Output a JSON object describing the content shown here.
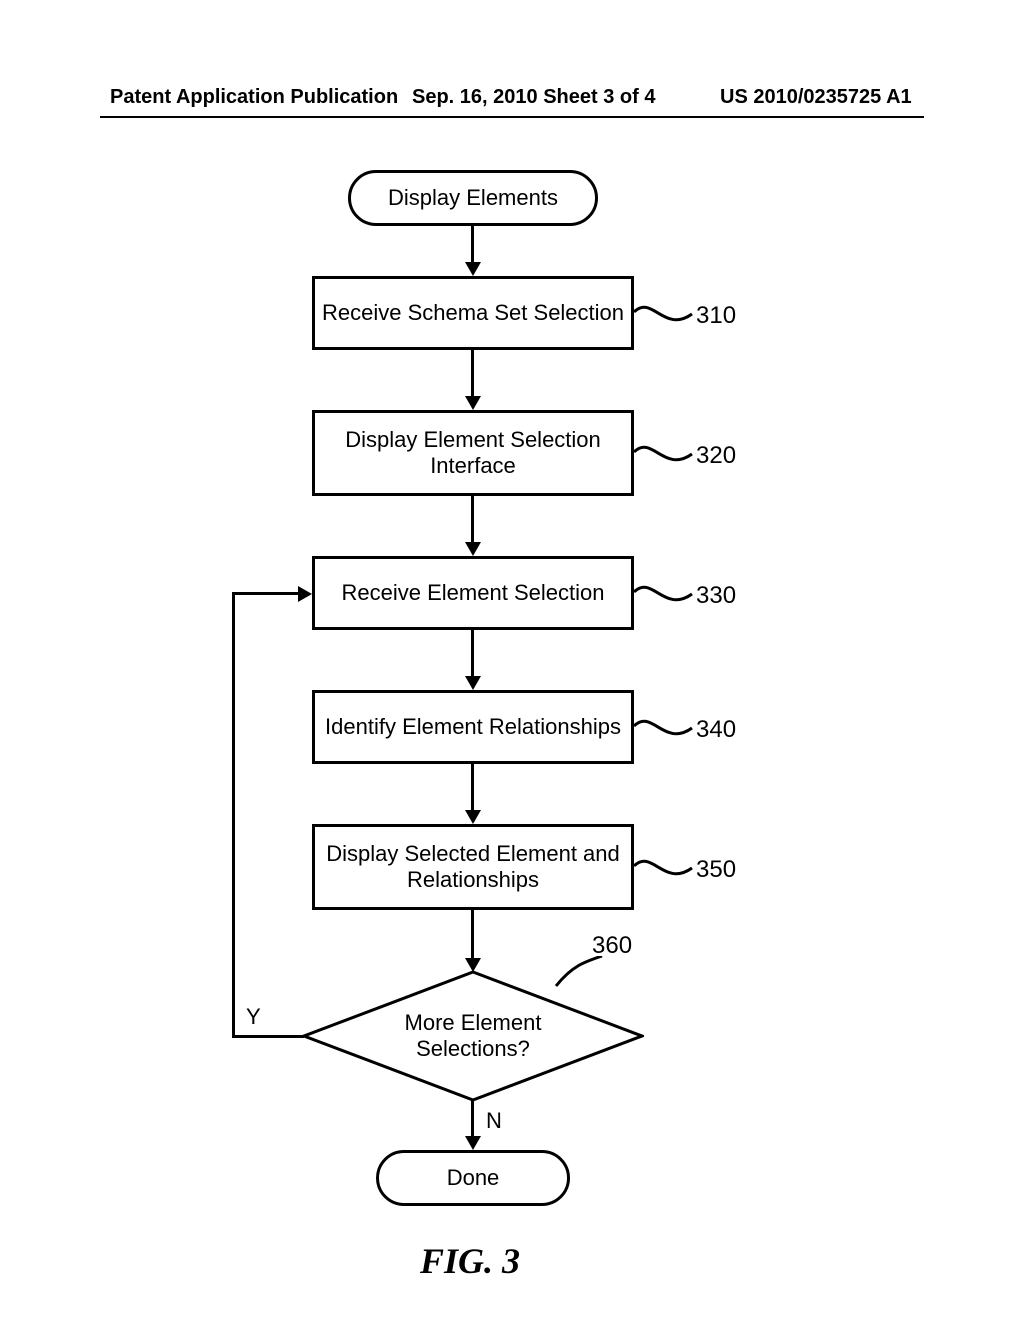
{
  "header": {
    "left": "Patent Application Publication",
    "center": "Sep. 16, 2010  Sheet 3 of 4",
    "right": "US 2010/0235725 A1"
  },
  "flow": {
    "start": "Display Elements",
    "b310": "Receive Schema Set Selection",
    "b320": "Display Element Selection\nInterface",
    "b330": "Receive Element Selection",
    "b340": "Identify Element Relationships",
    "b350": "Display Selected Element and\nRelationships",
    "decision": "More Element\nSelections?",
    "done": "Done"
  },
  "refs": {
    "r310": "310",
    "r320": "320",
    "r330": "330",
    "r340": "340",
    "r350": "350",
    "r360": "360"
  },
  "branches": {
    "yes": "Y",
    "no": "N"
  },
  "caption": "FIG. 3"
}
